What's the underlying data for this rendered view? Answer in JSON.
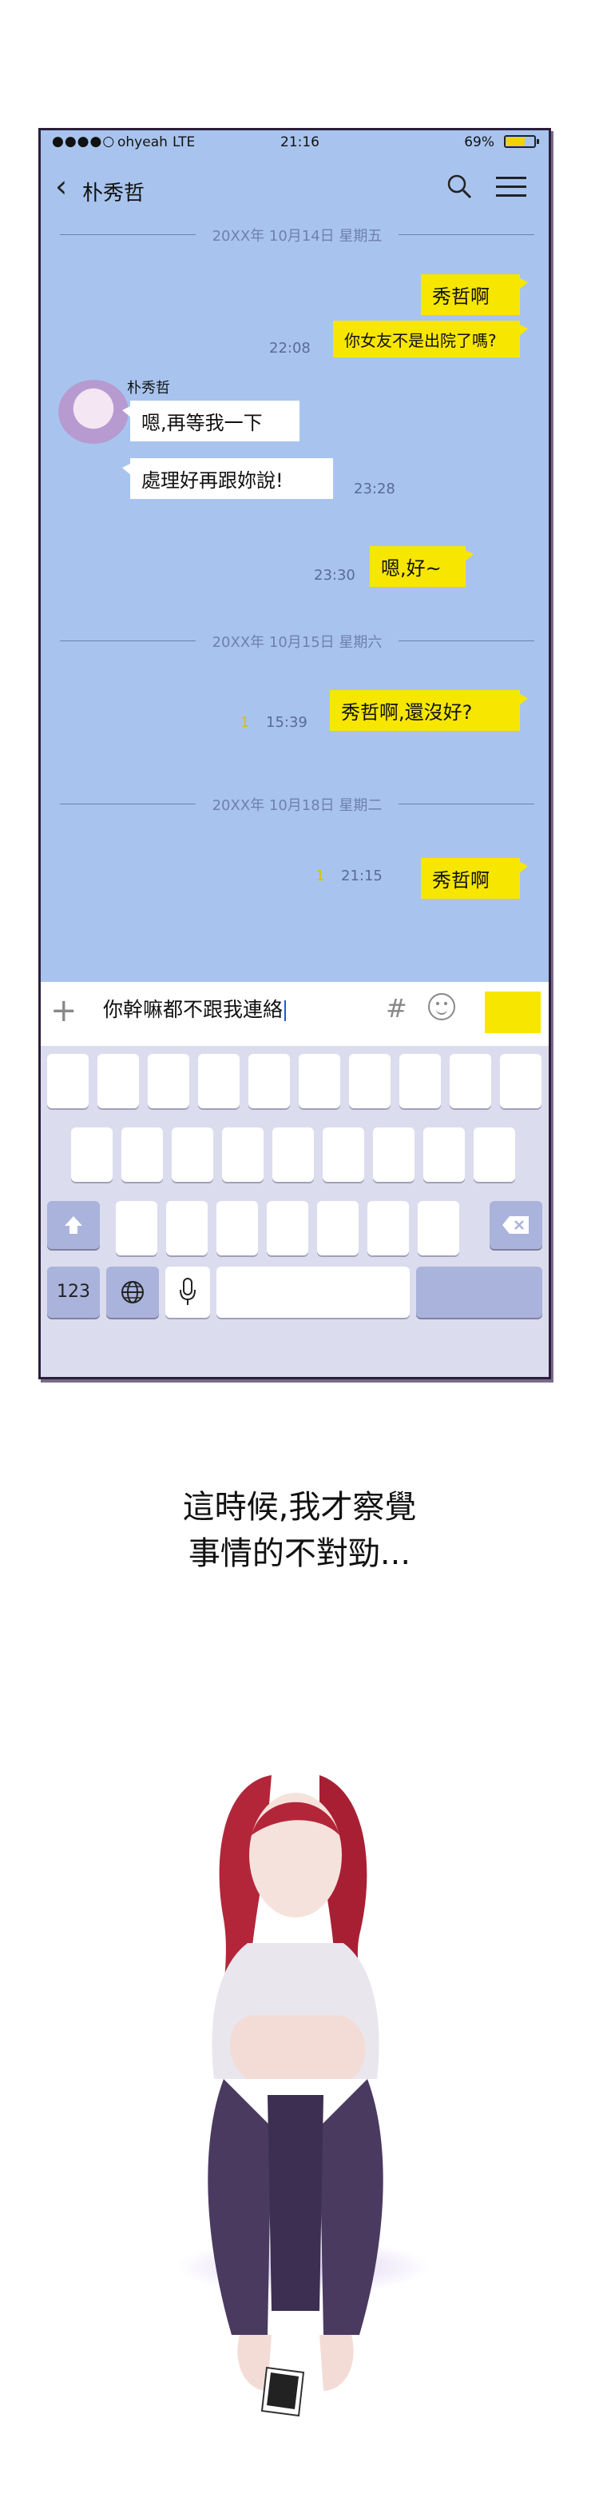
{
  "status_bar": {
    "signal": "●●●●○",
    "carrier": "ohyeah",
    "network": "LTE",
    "time": "21:16",
    "battery": "69%",
    "battery_level": 0.69
  },
  "header": {
    "title": "朴秀哲",
    "back_icon": "chevron-left-icon",
    "search_icon": "search-icon",
    "menu_icon": "menu-icon"
  },
  "dates": [
    "20XX年 10月14日 星期五",
    "20XX年 10月15日 星期六",
    "20XX年 10月18日 星期二"
  ],
  "messages": [
    {
      "from": "me",
      "text": "秀哲啊",
      "time": ""
    },
    {
      "from": "me",
      "text": "你女友不是出院了嗎?",
      "time": "22:08"
    },
    {
      "from": "them",
      "sender": "朴秀哲",
      "text": "嗯,再等我一下",
      "time": ""
    },
    {
      "from": "them",
      "text": "處理好再跟妳說!",
      "time": "23:28"
    },
    {
      "from": "me",
      "text": "嗯,好~",
      "time": "23:30"
    },
    {
      "from": "me",
      "text": "秀哲啊,還沒好?",
      "time": "15:39",
      "read": "1"
    },
    {
      "from": "me",
      "text": "秀哲啊",
      "time": "21:15",
      "read": "1"
    }
  ],
  "input": {
    "value": "你幹嘛都不跟我連絡",
    "plus_label": "+",
    "hash_label": "#"
  },
  "keyboard": {
    "numbers_key": "123",
    "globe_icon": "globe-icon",
    "mic_icon": "mic-icon",
    "shift_icon": "shift-icon",
    "delete_icon": "delete-icon"
  },
  "caption": {
    "line1": "這時候,我才察覺",
    "line2": "事情的不對勁..."
  },
  "colors": {
    "chat_bg": "#a8c4ee",
    "my_bubble": "#f7e600",
    "their_bubble": "#ffffff",
    "keyboard_bg": "#dcdcef"
  }
}
